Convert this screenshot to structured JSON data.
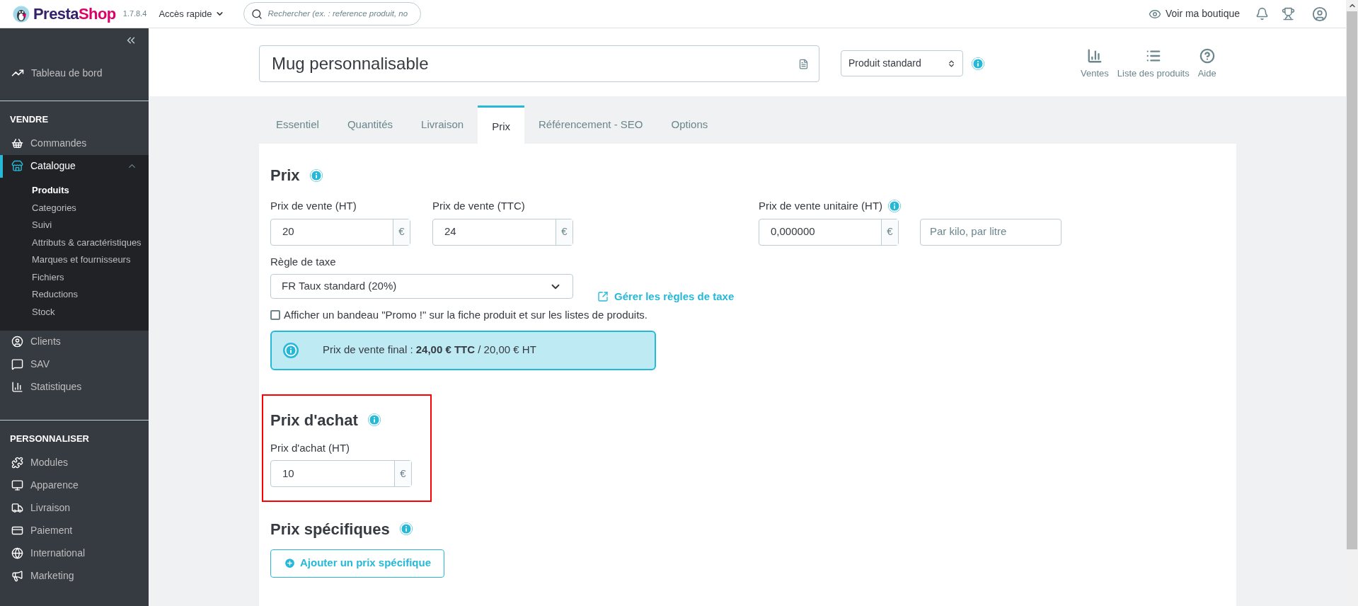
{
  "topbar": {
    "logo_first": "Presta",
    "logo_second": "Shop",
    "version": "1.7.8.4",
    "quick_access": "Accès rapide",
    "search_placeholder": "Rechercher (ex. : reference produit, no",
    "view_shop": "Voir ma boutique"
  },
  "sidebar": {
    "dashboard": {
      "label": "Tableau de bord",
      "selected": false
    },
    "sections": [
      {
        "title": "VENDRE",
        "items": [
          {
            "label": "Commandes",
            "selected": false,
            "expanded": false
          },
          {
            "label": "Catalogue",
            "selected": true,
            "expanded": true,
            "children": [
              {
                "label": "Produits",
                "selected": true
              },
              {
                "label": "Categories",
                "selected": false
              },
              {
                "label": "Suivi",
                "selected": false
              },
              {
                "label": "Attributs & caractéristiques",
                "selected": false
              },
              {
                "label": "Marques et fournisseurs",
                "selected": false
              },
              {
                "label": "Fichiers",
                "selected": false
              },
              {
                "label": "Reductions",
                "selected": false
              },
              {
                "label": "Stock",
                "selected": false
              }
            ]
          },
          {
            "label": "Clients",
            "selected": false,
            "expanded": false
          },
          {
            "label": "SAV",
            "selected": false,
            "expanded": false
          },
          {
            "label": "Statistiques",
            "selected": false,
            "expanded": false
          }
        ]
      },
      {
        "title": "PERSONNALISER",
        "items": [
          {
            "label": "Modules",
            "selected": false,
            "expanded": false
          },
          {
            "label": "Apparence",
            "selected": false,
            "expanded": false
          },
          {
            "label": "Livraison",
            "selected": false,
            "expanded": false
          },
          {
            "label": "Paiement",
            "selected": false,
            "expanded": false
          },
          {
            "label": "International",
            "selected": false,
            "expanded": false
          },
          {
            "label": "Marketing",
            "selected": false,
            "expanded": false
          }
        ]
      }
    ]
  },
  "header": {
    "product_name": "Mug personnalisable",
    "product_type": "Produit standard",
    "actions": [
      "Ventes",
      "Liste des produits",
      "Aide"
    ]
  },
  "tabs": [
    {
      "label": "Essentiel",
      "selected": false
    },
    {
      "label": "Quantités",
      "selected": false
    },
    {
      "label": "Livraison",
      "selected": false
    },
    {
      "label": "Prix",
      "selected": true
    },
    {
      "label": "Référencement - SEO",
      "selected": false
    },
    {
      "label": "Options",
      "selected": false
    }
  ],
  "price": {
    "title": "Prix",
    "fields": [
      {
        "label": "Prix de vente (HT)",
        "value": "20",
        "unit": "€"
      },
      {
        "label": "Prix de vente (TTC)",
        "value": "24",
        "unit": "€"
      }
    ],
    "unit_price": {
      "label": "Prix de vente unitaire (HT)",
      "value": "0,000000",
      "unit": "€",
      "per_placeholder": "Par kilo, par litre"
    },
    "tax_rule": {
      "label": "Règle de taxe",
      "value": "FR Taux standard (20%)",
      "link": "Gérer les règles de taxe"
    },
    "promo": {
      "label": "Afficher un bandeau \"Promo !\" sur la fiche produit et sur les listes de produits.",
      "checked": false
    },
    "final_price": "Prix de vente final : **24,00 € TTC** / 20,00 € HT"
  },
  "purchase": {
    "title": "Prix d'achat",
    "highlighted": true,
    "label": "Prix d'achat (HT)",
    "value": "10",
    "unit": "€"
  },
  "specific": {
    "title": "Prix spécifiques",
    "button": "Ajouter un prix spécifique"
  }
}
